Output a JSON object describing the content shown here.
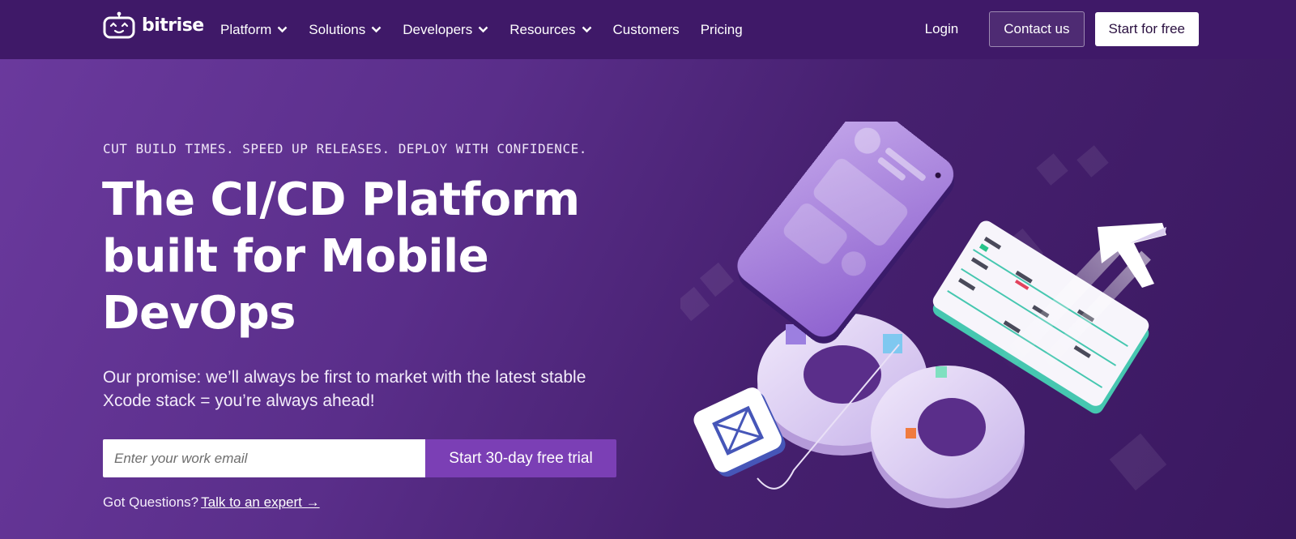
{
  "brand": {
    "name": "bitrise"
  },
  "nav": {
    "items": [
      {
        "label": "Platform",
        "has_dropdown": true
      },
      {
        "label": "Solutions",
        "has_dropdown": true
      },
      {
        "label": "Developers",
        "has_dropdown": true
      },
      {
        "label": "Resources",
        "has_dropdown": true
      },
      {
        "label": "Customers",
        "has_dropdown": false
      },
      {
        "label": "Pricing",
        "has_dropdown": false
      }
    ],
    "login": "Login",
    "contact": "Contact us",
    "start": "Start for free"
  },
  "hero": {
    "eyebrow": "CUT BUILD TIMES. SPEED UP RELEASES. DEPLOY WITH CONFIDENCE.",
    "headline_line1": "The CI/CD Platform",
    "headline_line2": "built for Mobile",
    "headline_line3": "DevOps",
    "promise": "Our promise: we’ll always be first to market with the latest stable Xcode stack = you’re always ahead!",
    "email_placeholder": "Enter your work email",
    "cta": "Start 30-day free trial",
    "questions": "Got Questions?",
    "expert_link": "Talk to an expert →"
  },
  "colors": {
    "topbar": "#3f1968",
    "bg_start": "#6b3a9e",
    "bg_end": "#3a1860",
    "cta": "#7b3fb5"
  },
  "icons": {
    "logo": "bitrise-robot-logo",
    "dropdown": "chevron-down-icon"
  }
}
